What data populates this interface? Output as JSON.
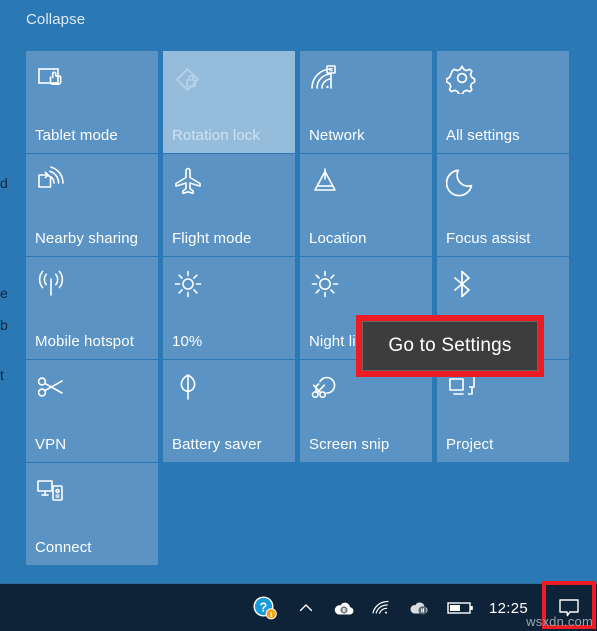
{
  "action_center": {
    "collapse_label": "Collapse",
    "edge_fragments": [
      "d",
      "e",
      "b",
      "t"
    ],
    "tiles": [
      {
        "label": "Tablet mode",
        "icon": "tablet-mode-icon",
        "state": "on"
      },
      {
        "label": "Rotation lock",
        "icon": "rotation-lock-icon",
        "state": "disabled"
      },
      {
        "label": "Network",
        "icon": "network-icon",
        "state": "on"
      },
      {
        "label": "All settings",
        "icon": "gear-icon",
        "state": "on"
      },
      {
        "label": "Nearby sharing",
        "icon": "nearby-sharing-icon",
        "state": "on"
      },
      {
        "label": "Flight mode",
        "icon": "airplane-icon",
        "state": "on"
      },
      {
        "label": "Location",
        "icon": "location-icon",
        "state": "on"
      },
      {
        "label": "Focus assist",
        "icon": "moon-icon",
        "state": "on"
      },
      {
        "label": "Mobile hotspot",
        "icon": "hotspot-icon",
        "state": "on"
      },
      {
        "label": "10%",
        "icon": "brightness-icon",
        "state": "on"
      },
      {
        "label": "Night light",
        "icon": "sun-icon",
        "state": "on"
      },
      {
        "label": "",
        "icon": "bluetooth-icon",
        "state": "on"
      },
      {
        "label": "VPN",
        "icon": "vpn-icon",
        "state": "on"
      },
      {
        "label": "Battery saver",
        "icon": "leaf-icon",
        "state": "on"
      },
      {
        "label": "Screen snip",
        "icon": "screen-snip-icon",
        "state": "on"
      },
      {
        "label": "Project",
        "icon": "project-icon",
        "state": "on"
      },
      {
        "label": "Connect",
        "icon": "connect-icon",
        "state": "on"
      }
    ]
  },
  "tooltip": {
    "text": "Go to Settings",
    "highlight_color": "#ed1c24",
    "background_color": "#3d3d3d"
  },
  "taskbar": {
    "clock": "12:25",
    "tray_icons": [
      "help-icon",
      "show-hidden-icons-chevron-icon",
      "onedrive-paused-icon",
      "wifi-icon",
      "cloud-paused-icon",
      "battery-icon"
    ],
    "notification_icon": "action-center-icon",
    "notification_highlight_color": "#ed1c24"
  },
  "watermark": {
    "text": "wsxdn.com"
  },
  "colors": {
    "panel_background": "#2a79b5",
    "tile_background": "#5a93c4",
    "tile_disabled_background": "#96bcdc",
    "taskbar_background": "#0e2337",
    "accent_red": "#ed1c24"
  }
}
